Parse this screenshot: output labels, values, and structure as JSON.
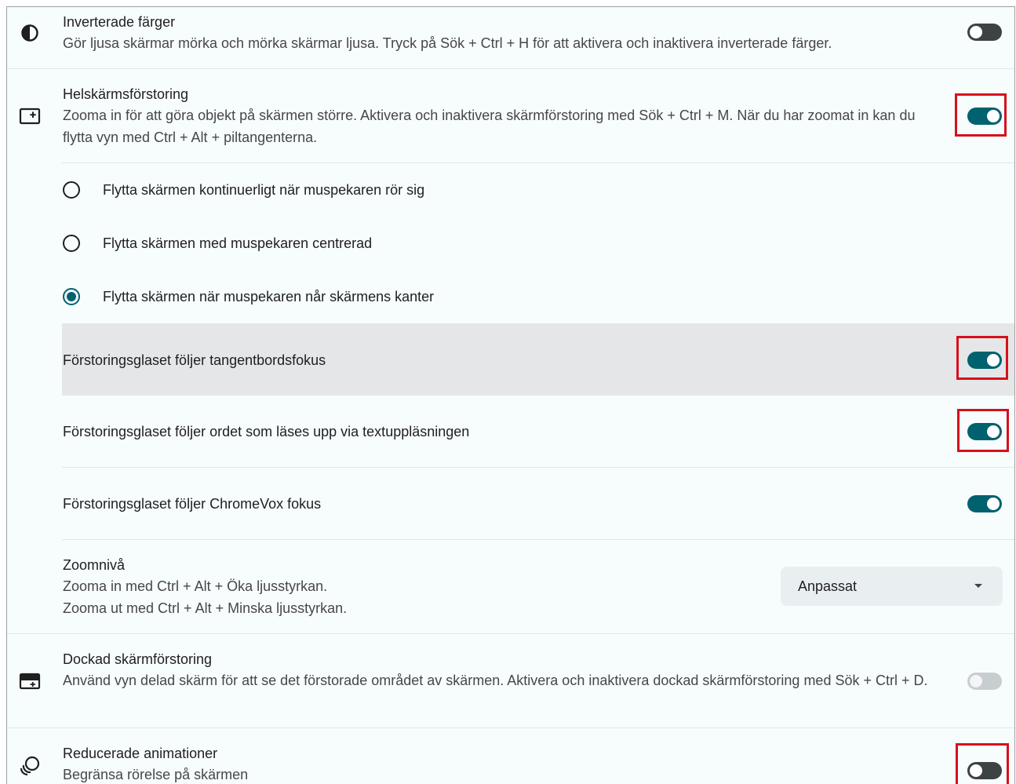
{
  "settings": {
    "inverted_colors": {
      "title": "Inverterade färger",
      "description": "Gör ljusa skärmar mörka och mörka skärmar ljusa. Tryck på Sök + Ctrl + H för att aktivera och inaktivera inverterade färger.",
      "icon": "invert-colors-icon",
      "enabled": false
    },
    "fullscreen_magnifier": {
      "title": "Helskärmsförstoring",
      "description": "Zooma in för att göra objekt på skärmen större. Aktivera och inaktivera skärmförstoring med Sök + Ctrl + M. När du har zoomat in kan du flytta vyn med Ctrl + Alt + piltangenterna.",
      "icon": "fullscreen-magnifier-icon",
      "enabled": true
    },
    "mouse_follow_options": [
      {
        "label": "Flytta skärmen kontinuerligt när muspekaren rör sig",
        "selected": false
      },
      {
        "label": "Flytta skärmen med muspekaren centrerad",
        "selected": false
      },
      {
        "label": "Flytta skärmen när muspekaren når skärmens kanter",
        "selected": true
      }
    ],
    "follow_keyboard_focus": {
      "title": "Förstoringsglaset följer tangentbordsfokus",
      "enabled": true
    },
    "follow_select_to_speak": {
      "title": "Förstoringsglaset följer ordet som läses upp via textuppläsningen",
      "enabled": true
    },
    "follow_chromevox": {
      "title": "Förstoringsglaset följer ChromeVox fokus",
      "enabled": true
    },
    "zoom_level": {
      "title": "Zoomnivå",
      "description_line1": "Zooma in med Ctrl + Alt + Öka ljusstyrkan.",
      "description_line2": "Zooma ut med Ctrl + Alt + Minska ljusstyrkan.",
      "selected_value": "Anpassat"
    },
    "docked_magnifier": {
      "title": "Dockad skärmförstoring",
      "description": "Använd vyn delad skärm för att se det förstorade området av skärmen. Aktivera och inaktivera dockad skärmförstoring med Sök + Ctrl + D.",
      "icon": "docked-magnifier-icon",
      "enabled": false
    },
    "reduced_animations": {
      "title": "Reducerade animationer",
      "description": "Begränsa rörelse på skärmen",
      "icon": "reduced-motion-icon",
      "enabled": false
    }
  },
  "colors": {
    "accent": "#00616f",
    "highlight_box": "#d6101c",
    "hover_row": "#e4e6e8",
    "background": "#f7fcfd"
  }
}
